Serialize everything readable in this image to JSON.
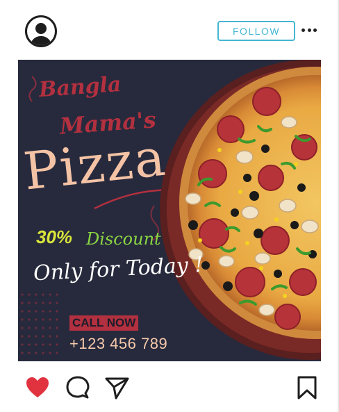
{
  "header": {
    "follow_label": "FOLLOW"
  },
  "post": {
    "brand_line_1": "Bangla",
    "brand_line_2": "Mama's",
    "headline": "Pizza",
    "discount_percent": "30%",
    "discount_label": "Discount",
    "tagline": "Only for Today !",
    "cta_label": "CALL NOW",
    "phone": "+123 456 789"
  },
  "colors": {
    "background": "#272a3d",
    "brand_red": "#b2303f",
    "headline_peach": "#f4c3a5",
    "discount_yellow": "#d9e53a",
    "discount_green": "#8bd742",
    "follow_blue": "#45b6d3",
    "like_red": "#e0333f"
  },
  "icons": {
    "avatar": "user-circle-icon",
    "more": "more-horizontal-icon",
    "like": "heart-filled-icon",
    "comment": "comment-bubble-icon",
    "share": "paper-plane-icon",
    "save": "bookmark-icon"
  }
}
